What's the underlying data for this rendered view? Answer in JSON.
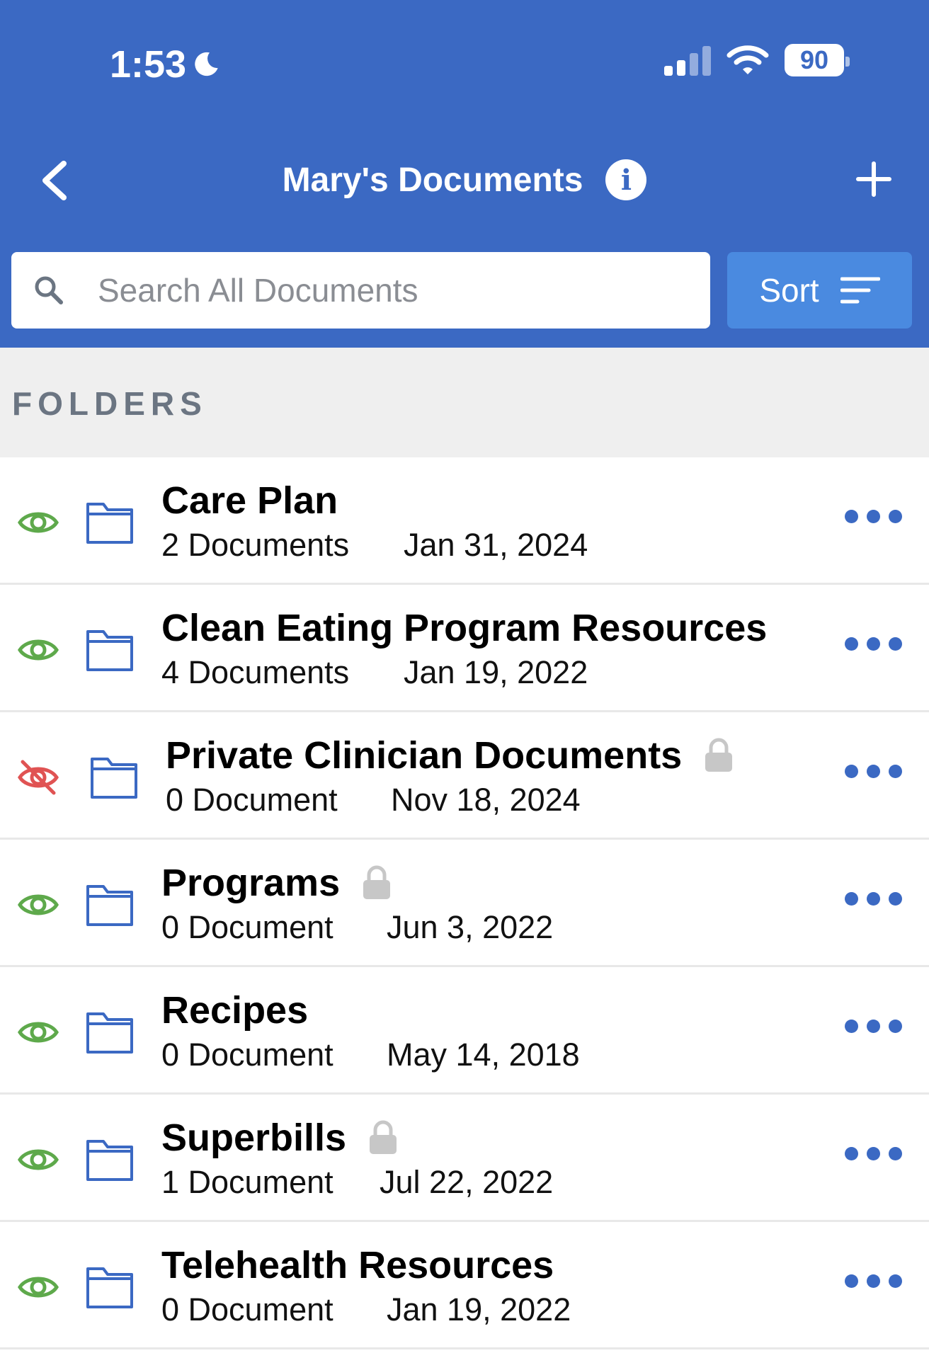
{
  "status_bar": {
    "time": "1:53",
    "battery": "90"
  },
  "header": {
    "title": "Mary's Documents"
  },
  "search": {
    "placeholder": "Search All Documents"
  },
  "sort": {
    "label": "Sort"
  },
  "section": {
    "label": "FOLDERS"
  },
  "colors": {
    "brand": "#3b69c3",
    "sort_button": "#4a8ae0",
    "visible_eye": "#5ea94b",
    "hidden_eye": "#e05353",
    "lock": "#c7c7c7"
  },
  "folders": [
    {
      "name": "Care Plan",
      "count": "2 Documents",
      "date": "Jan 31, 2024",
      "visible": true,
      "locked": false
    },
    {
      "name": "Clean Eating Program Resources",
      "count": "4 Documents",
      "date": "Jan 19, 2022",
      "visible": true,
      "locked": false
    },
    {
      "name": "Private Clinician Documents",
      "count": "0 Document",
      "date": "Nov 18, 2024",
      "visible": false,
      "locked": true
    },
    {
      "name": "Programs",
      "count": "0 Document",
      "date": "Jun 3, 2022",
      "visible": true,
      "locked": true
    },
    {
      "name": "Recipes",
      "count": "0 Document",
      "date": "May 14, 2018",
      "visible": true,
      "locked": false
    },
    {
      "name": "Superbills",
      "count": "1 Document",
      "date": "Jul 22, 2022",
      "visible": true,
      "locked": true
    },
    {
      "name": "Telehealth Resources",
      "count": "0 Document",
      "date": "Jan 19, 2022",
      "visible": true,
      "locked": false
    }
  ]
}
